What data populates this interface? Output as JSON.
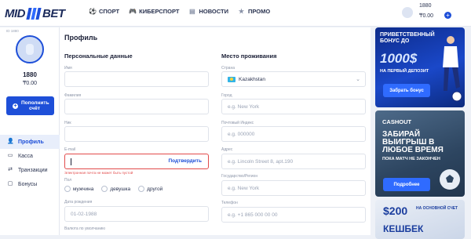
{
  "header": {
    "logo_left": "MID",
    "logo_right": "BET",
    "nav": [
      {
        "label": "СПОРТ",
        "icon": "sport-icon"
      },
      {
        "label": "КИБЕРСПОРТ",
        "icon": "gamepad-icon"
      },
      {
        "label": "НОВОСТИ",
        "icon": "news-icon"
      },
      {
        "label": "ПРОМО",
        "icon": "star-icon"
      }
    ],
    "account": {
      "id": "1880",
      "balance": "₸0.00"
    }
  },
  "sidebar": {
    "small_id": "ID 1880",
    "number": "1880",
    "balance": "₸0.00",
    "topup_label": "Пополнить счёт",
    "items": [
      {
        "label": "Профиль",
        "icon": "user-icon",
        "active": true
      },
      {
        "label": "Касса",
        "icon": "cash-icon",
        "active": false
      },
      {
        "label": "Транзакции",
        "icon": "transfer-icon",
        "active": false
      },
      {
        "label": "Бонусы",
        "icon": "gift-icon",
        "active": false
      }
    ]
  },
  "profile": {
    "title": "Профиль",
    "personal_title": "Персональные данные",
    "residence_title": "Место проживания",
    "fields_left": {
      "first_name": {
        "label": "Имя",
        "placeholder": ""
      },
      "last_name": {
        "label": "Фамилия",
        "placeholder": ""
      },
      "nick": {
        "label": "Ник",
        "placeholder": ""
      },
      "email": {
        "label": "E-mail",
        "placeholder": "",
        "confirm": "Подтвердить",
        "error": "Электронная почта не может быть пустой"
      },
      "gender": {
        "label": "Пол",
        "options": [
          "мужчина",
          "девушка",
          "другой"
        ]
      },
      "birth": {
        "label": "Дата рождения",
        "placeholder": "01-02-1988"
      },
      "currency": {
        "label": "Валюта по умолчанию"
      }
    },
    "fields_right": {
      "country": {
        "label": "Страна",
        "value": "Kazakhstan"
      },
      "city": {
        "label": "Город",
        "placeholder": "e.g. New York"
      },
      "zip": {
        "label": "Почтовый Индекс",
        "placeholder": "e.g. 000000"
      },
      "address": {
        "label": "Адрес",
        "placeholder": "e.g. Lincoln Street 8, apt.190"
      },
      "state": {
        "label": "Государство/Регион",
        "placeholder": "e.g. New York"
      },
      "phone": {
        "label": "Телефон",
        "placeholder": "e.g. +1 865 000 00 00"
      }
    }
  },
  "banners": {
    "b1": {
      "title": "ПРИВЕТСТВЕННЫЙ БОНУС ДО",
      "amount": "1000$",
      "sub": "НА ПЕРВЫЙ ДЕПОЗИТ",
      "button": "Забрать бонус"
    },
    "b2": {
      "tag": "CASHOUT",
      "title": "ЗАБИРАЙ ВЫИГРЫШ В ЛЮБОЕ ВРЕМЯ",
      "sub": "ПОКА МАТЧ НЕ ЗАКОНЧЕН",
      "button": "Подробнее"
    },
    "b3": {
      "amount": "$200",
      "sub": "НА ОСНОВНОЙ СЧЕТ",
      "title": "КЕШБЕК"
    }
  },
  "colors": {
    "accent": "#1e4fd8",
    "error": "#e24b4b",
    "background": "#eef1f7"
  }
}
